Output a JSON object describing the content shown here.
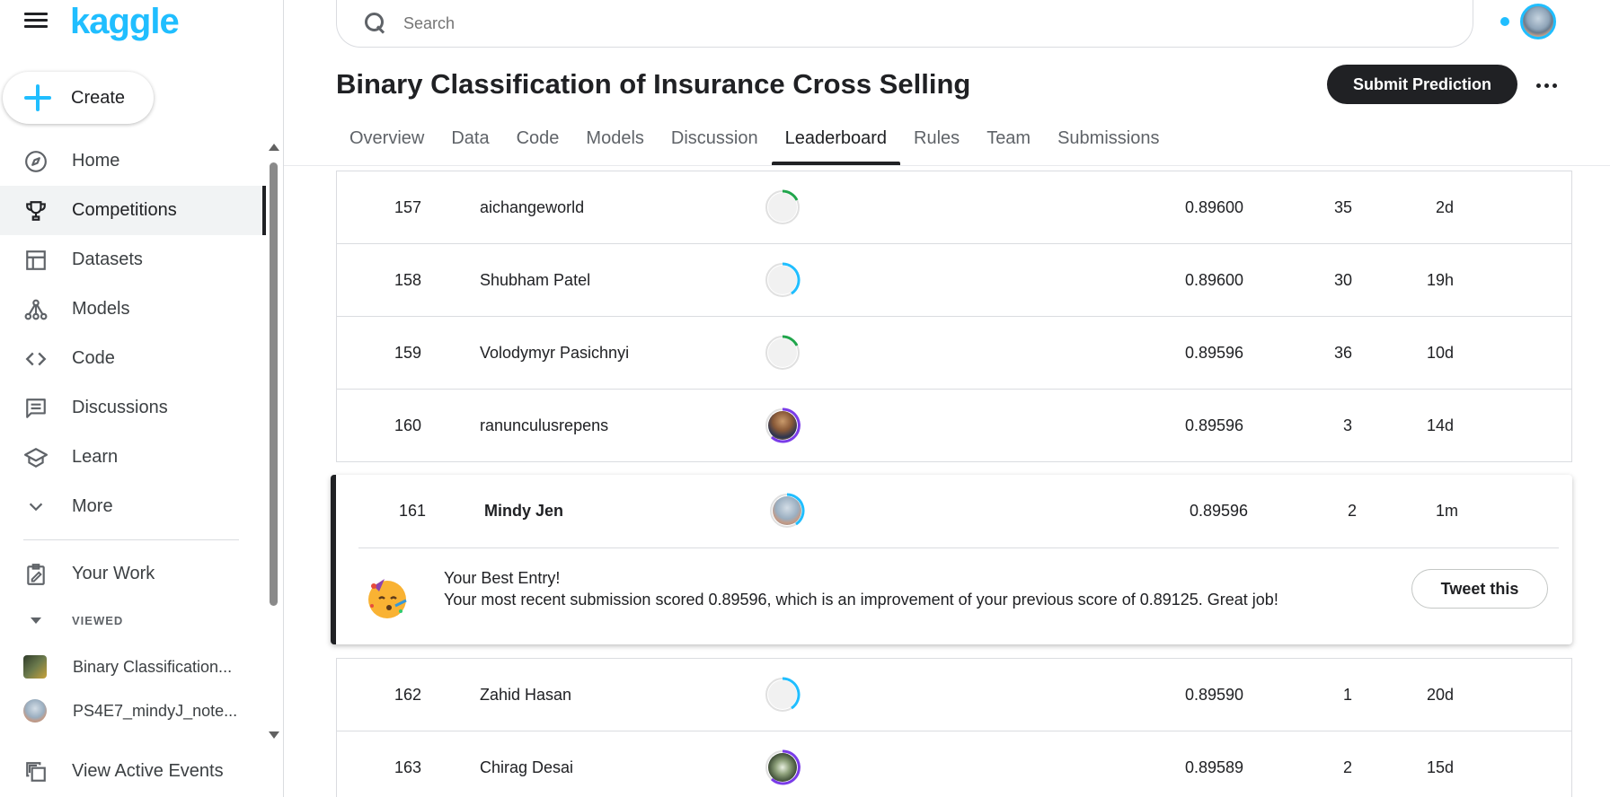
{
  "sidebar": {
    "logo": "kaggle",
    "create_label": "Create",
    "items": [
      {
        "label": "Home",
        "icon": "compass-icon"
      },
      {
        "label": "Competitions",
        "icon": "trophy-icon",
        "active": true
      },
      {
        "label": "Datasets",
        "icon": "table-icon"
      },
      {
        "label": "Models",
        "icon": "models-icon"
      },
      {
        "label": "Code",
        "icon": "code-icon"
      },
      {
        "label": "Discussions",
        "icon": "comment-icon"
      },
      {
        "label": "Learn",
        "icon": "school-icon"
      },
      {
        "label": "More",
        "icon": "chevron-down-icon"
      }
    ],
    "your_work": "Your Work",
    "viewed_label": "VIEWED",
    "viewed_items": [
      {
        "label": "Binary Classification..."
      },
      {
        "label": "PS4E7_mindyJ_note..."
      }
    ],
    "active_events": "View Active Events"
  },
  "header": {
    "search_placeholder": "Search",
    "title": "Binary Classification of Insurance Cross Selling",
    "submit_label": "Submit Prediction",
    "tabs": [
      "Overview",
      "Data",
      "Code",
      "Models",
      "Discussion",
      "Leaderboard",
      "Rules",
      "Team",
      "Submissions"
    ],
    "active_tab": "Leaderboard"
  },
  "leaderboard": {
    "rows_top": [
      {
        "rank": "157",
        "name": "aichangeworld",
        "score": "0.89600",
        "entries": "35",
        "last": "2d"
      },
      {
        "rank": "158",
        "name": "Shubham Patel",
        "score": "0.89600",
        "entries": "30",
        "last": "19h"
      },
      {
        "rank": "159",
        "name": "Volodymyr Pasichnyi",
        "score": "0.89596",
        "entries": "36",
        "last": "10d"
      },
      {
        "rank": "160",
        "name": "ranunculusrepens",
        "score": "0.89596",
        "entries": "3",
        "last": "14d"
      }
    ],
    "own_row": {
      "rank": "161",
      "name": "Mindy Jen",
      "score": "0.89596",
      "entries": "2",
      "last": "1m"
    },
    "best_entry": {
      "title": "Your Best Entry!",
      "message": "Your most recent submission scored 0.89596, which is an improvement of your previous score of 0.89125. Great job!",
      "tweet_label": "Tweet this"
    },
    "rows_bottom": [
      {
        "rank": "162",
        "name": "Zahid Hasan",
        "score": "0.89590",
        "entries": "1",
        "last": "20d"
      },
      {
        "rank": "163",
        "name": "Chirag Desai",
        "score": "0.89589",
        "entries": "2",
        "last": "15d"
      }
    ]
  },
  "colors": {
    "accent": "#20beff",
    "dark": "#202124",
    "tier_green": "#20a54b",
    "tier_blue": "#20beff",
    "tier_purple": "#7a3ce8"
  }
}
